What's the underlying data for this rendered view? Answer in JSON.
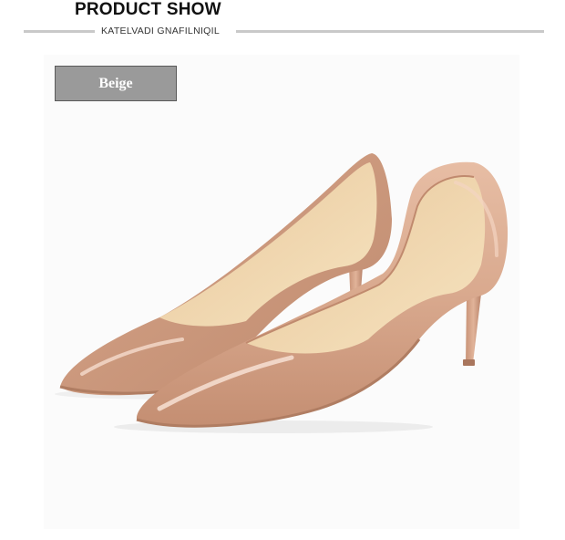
{
  "header": {
    "title": "PRODUCT SHOW",
    "subtitle": "KATELVADI GNAFILNIQIL"
  },
  "product": {
    "color_label": "Beige",
    "image_icon": "beige-pointed-pump-pair-icon",
    "colors": {
      "shoe": "#d9a98e",
      "insole": "#f2d9b0",
      "label_bg": "#9a9a9a"
    }
  }
}
